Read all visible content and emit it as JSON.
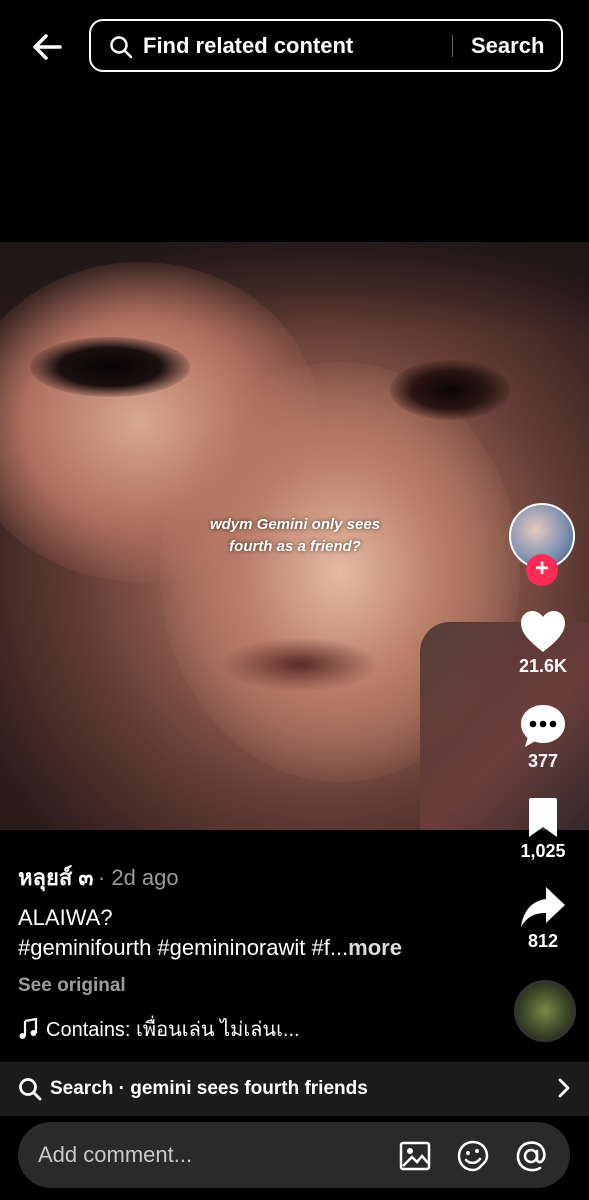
{
  "header": {
    "search_placeholder": "Find related content",
    "search_button": "Search"
  },
  "video": {
    "caption": "wdym Gemini only sees fourth as a friend?"
  },
  "actions": {
    "likes": "21.6K",
    "comments": "377",
    "saves": "1,025",
    "shares": "812"
  },
  "post": {
    "author": "หลุยส์ ๓",
    "time": "· 2d ago",
    "description_line1": "ALAIWA?",
    "description_line2": "#geminifourth #gemininorawit #f...",
    "more": "more",
    "see_original": "See original",
    "music": "Contains: เพื่อนเล่น ไม่เล่นเ..."
  },
  "related_search": {
    "label": "Search · gemini sees fourth friends"
  },
  "comment_bar": {
    "placeholder": "Add comment..."
  },
  "colors": {
    "accent": "#fe2c55",
    "background": "#000000"
  }
}
